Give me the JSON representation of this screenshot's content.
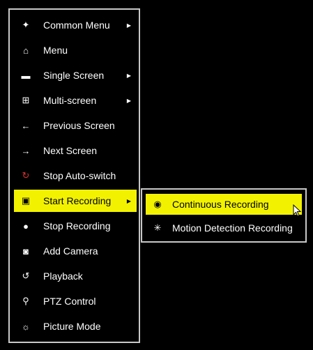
{
  "menu": {
    "items": [
      {
        "label": "Common Menu",
        "icon": "common-menu-icon",
        "glyph": "✦",
        "submenu": true
      },
      {
        "label": "Menu",
        "icon": "home-icon",
        "glyph": "⌂",
        "submenu": false
      },
      {
        "label": "Single Screen",
        "icon": "camera-icon",
        "glyph": "▬",
        "submenu": true
      },
      {
        "label": "Multi-screen",
        "icon": "grid-icon",
        "glyph": "⊞",
        "submenu": true
      },
      {
        "label": "Previous Screen",
        "icon": "arrow-left-icon",
        "glyph": "←",
        "submenu": false
      },
      {
        "label": "Next Screen",
        "icon": "arrow-right-icon",
        "glyph": "→",
        "submenu": false
      },
      {
        "label": "Stop Auto-switch",
        "icon": "stop-switch-icon",
        "glyph": "↻",
        "submenu": false
      },
      {
        "label": "Start Recording",
        "icon": "record-icon",
        "glyph": "▣",
        "submenu": true,
        "active": true
      },
      {
        "label": "Stop Recording",
        "icon": "stop-record-icon",
        "glyph": "●",
        "submenu": false
      },
      {
        "label": "Add Camera",
        "icon": "add-camera-icon",
        "glyph": "◙",
        "submenu": false
      },
      {
        "label": "Playback",
        "icon": "playback-icon",
        "glyph": "↺",
        "submenu": false
      },
      {
        "label": "PTZ Control",
        "icon": "ptz-icon",
        "glyph": "⚲",
        "submenu": false
      },
      {
        "label": "Picture Mode",
        "icon": "picture-mode-icon",
        "glyph": "☼",
        "submenu": false
      }
    ]
  },
  "submenu": {
    "items": [
      {
        "label": "Continuous Recording",
        "icon": "continuous-record-icon",
        "glyph": "◉",
        "active": true
      },
      {
        "label": "Motion Detection Recording",
        "icon": "motion-detection-icon",
        "glyph": "✳",
        "active": false
      }
    ]
  },
  "colors": {
    "highlight": "#f2f200",
    "border": "#c8c8c8",
    "background": "#000000",
    "text": "#ffffff"
  }
}
